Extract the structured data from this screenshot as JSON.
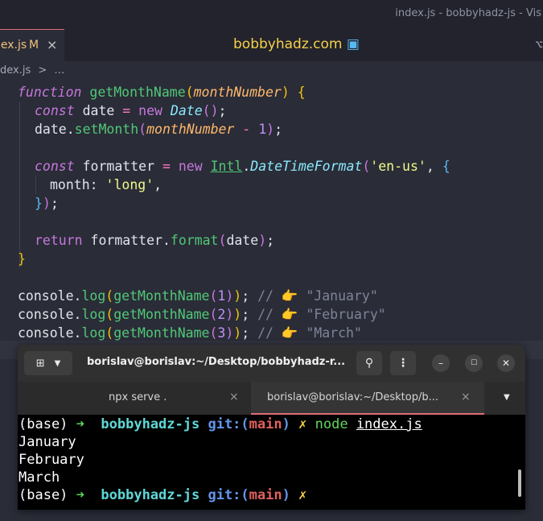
{
  "window": {
    "title": "index.js - bobbyhadz-js - Vis"
  },
  "editor_tab": {
    "name": "dex.js",
    "modified": "M",
    "close": "×"
  },
  "brand": {
    "text": "bobbyhadz.com",
    "icon": "cube-icon"
  },
  "breadcrumb": {
    "file": "dex.js",
    "sep": ">",
    "more": "…"
  },
  "code": {
    "l1": {
      "kw": "function",
      "fn": "getMonthName",
      "p1": "(",
      "param": "monthNumber",
      "p2": ")",
      "sp": " ",
      "b": "{"
    },
    "l2": {
      "kw": "const",
      "var": " date ",
      "op": "=",
      "sp": " ",
      "kw2": "new",
      "cls": "Date",
      "p": "()",
      "semi": ";"
    },
    "l3": {
      "obj": "date.",
      "fn": "setMonth",
      "p1": "(",
      "param": "monthNumber",
      "op": " - ",
      "num": "1",
      "p2": ")",
      "semi": ";"
    },
    "l5": {
      "kw": "const",
      "var": " formatter ",
      "op": "=",
      "sp": " ",
      "kw2": "new",
      "obj": "Intl",
      "dot": ".",
      "cls": "DateTimeFormat",
      "p1": "(",
      "str": "'en-us'",
      "comma": ", ",
      "b": "{"
    },
    "l6": {
      "key": "month: ",
      "str": "'long'",
      "comma": ","
    },
    "l7": {
      "b": "}",
      "p": ")",
      "semi": ";"
    },
    "l9": {
      "kw": "return",
      "obj": " formatter.",
      "fn": "format",
      "p1": "(",
      "arg": "date",
      "p2": ")",
      "semi": ";"
    },
    "l10": {
      "b": "}"
    },
    "logs": [
      {
        "obj": "console.",
        "fn": "log",
        "call": "getMonthName",
        "num": "1",
        "comment": "// 👉 \"January\""
      },
      {
        "obj": "console.",
        "fn": "log",
        "call": "getMonthName",
        "num": "2",
        "comment": "// 👉 \"February\""
      },
      {
        "obj": "console.",
        "fn": "log",
        "call": "getMonthName",
        "num": "3",
        "comment": "// 👉 \"March\""
      }
    ],
    "paren_open": "(",
    "paren_close": ")",
    "semi": ";"
  },
  "terminal": {
    "title": "borislav@borislav:~/Desktop/bobbyhadz-r...",
    "new_tab_icon": "plus-tab-icon",
    "tabs": [
      {
        "label": "npx serve .",
        "close": "×"
      },
      {
        "label": "borislav@borislav:~/Desktop/b...",
        "close": "×"
      }
    ],
    "lines": {
      "prompt": {
        "env": "(base) ",
        "arrow": "➜",
        "repo": "bobbyhadz-js",
        "git": "git:(",
        "branch": "main",
        "git_close": ")",
        "dirty": "✗"
      },
      "command": {
        "cmd": "node",
        "arg": "index.js"
      },
      "output": [
        "January",
        "February",
        "March"
      ]
    }
  }
}
